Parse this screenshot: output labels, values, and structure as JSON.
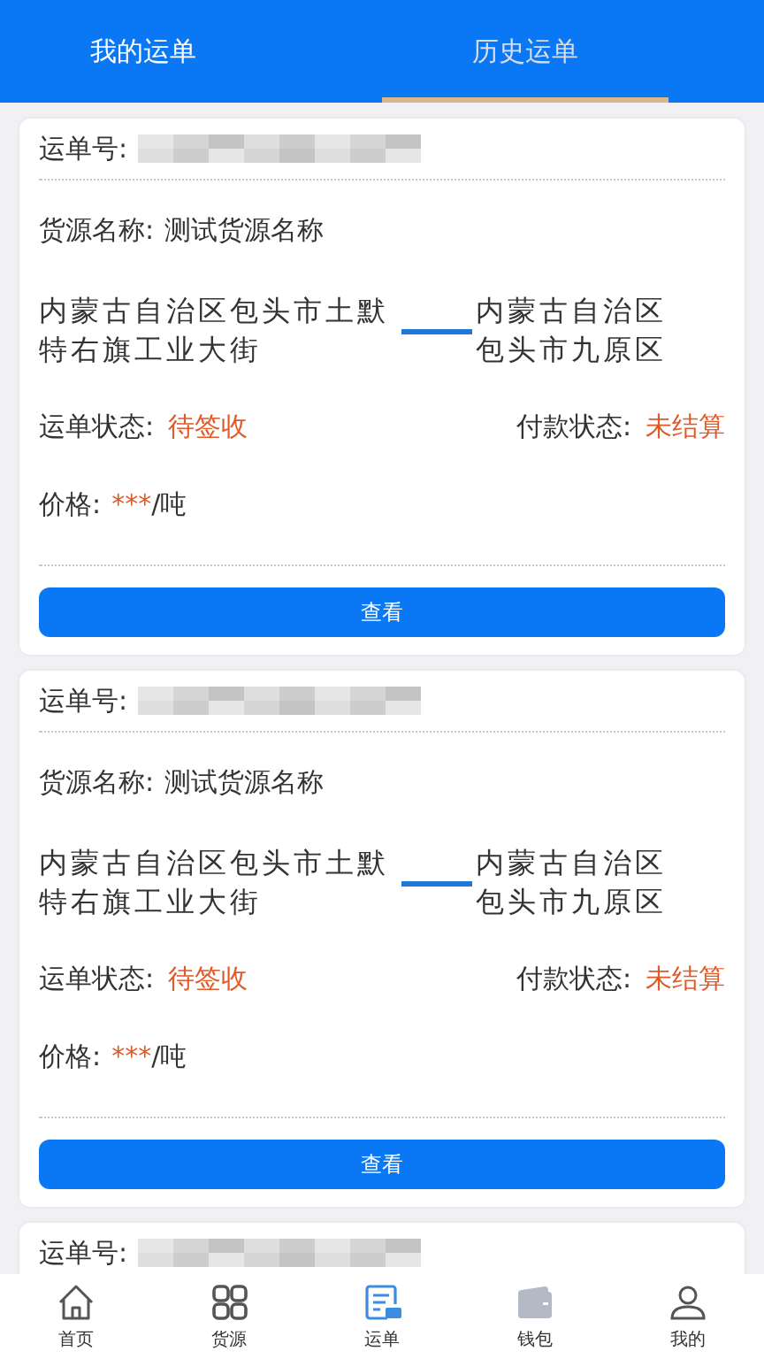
{
  "tabs": [
    {
      "label": "我的运单",
      "selected": false
    },
    {
      "label": "历史运单",
      "selected": true
    }
  ],
  "cards": [
    {
      "order_label": "运单号:",
      "order_no_redacted": true,
      "source_label": "货源名称:",
      "source_name": "测试货源名称",
      "from": "内蒙古自治区包头市土默特右旗工业大街",
      "to": "内蒙古自治区包头市九原区",
      "status_label": "运单状态:",
      "status": "待签收",
      "pay_label": "付款状态:",
      "pay_status": "未结算",
      "price_label": "价格:",
      "price_value": "***",
      "price_unit": "/吨",
      "button": "查看"
    },
    {
      "order_label": "运单号:",
      "order_no_redacted": true,
      "source_label": "货源名称:",
      "source_name": "测试货源名称",
      "from": "内蒙古自治区包头市土默特右旗工业大街",
      "to": "内蒙古自治区包头市九原区",
      "status_label": "运单状态:",
      "status": "待签收",
      "pay_label": "付款状态:",
      "pay_status": "未结算",
      "price_label": "价格:",
      "price_value": "***",
      "price_unit": "/吨",
      "button": "查看"
    },
    {
      "order_label": "运单号:",
      "order_no_redacted": true
    }
  ],
  "nav": [
    {
      "label": "首页",
      "kind": "home",
      "selected": false
    },
    {
      "label": "货源",
      "kind": "grid",
      "selected": false
    },
    {
      "label": "运单",
      "kind": "waybill",
      "selected": true
    },
    {
      "label": "钱包",
      "kind": "wallet",
      "selected": false
    },
    {
      "label": "我的",
      "kind": "person",
      "selected": false
    }
  ]
}
